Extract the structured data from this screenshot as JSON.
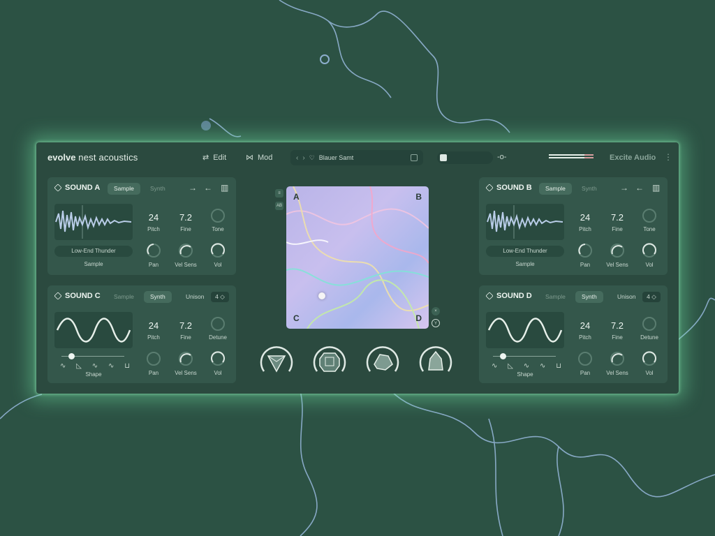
{
  "brand": {
    "bold": "evolve",
    "rest": " nest acoustics"
  },
  "header": {
    "edit_label": "Edit",
    "mod_label": "Mod",
    "preset_name": "Blauer Samt",
    "vendor": "Excite Audio",
    "menu": "⋮"
  },
  "sounds": {
    "a": {
      "title": "SOUND A",
      "tab_sample": "Sample",
      "tab_synth": "Synth",
      "pitch": "24",
      "pitch_label": "Pitch",
      "fine": "7.2",
      "fine_label": "Fine",
      "third_label": "Tone",
      "sample_name": "Low-End Thunder",
      "sample_label": "Sample",
      "pan_label": "Pan",
      "velsens_label": "Vel Sens",
      "vol_label": "Vol"
    },
    "b": {
      "title": "SOUND B",
      "tab_sample": "Sample",
      "tab_synth": "Synth",
      "pitch": "24",
      "pitch_label": "Pitch",
      "fine": "7.2",
      "fine_label": "Fine",
      "third_label": "Tone",
      "sample_name": "Low-End Thunder",
      "sample_label": "Sample",
      "pan_label": "Pan",
      "velsens_label": "Vel Sens",
      "vol_label": "Vol"
    },
    "c": {
      "title": "SOUND C",
      "tab_sample": "Sample",
      "tab_synth": "Synth",
      "unison_label": "Unison",
      "unison_value": "4 ◇",
      "pitch": "24",
      "pitch_label": "Pitch",
      "fine": "7.2",
      "fine_label": "Fine",
      "third_label": "Detune",
      "shape_label": "Shape",
      "pan_label": "Pan",
      "velsens_label": "Vel Sens",
      "vol_label": "Vol"
    },
    "d": {
      "title": "SOUND D",
      "tab_sample": "Sample",
      "tab_synth": "Synth",
      "unison_label": "Unison",
      "unison_value": "4 ◇",
      "pitch": "24",
      "pitch_label": "Pitch",
      "fine": "7.2",
      "fine_label": "Fine",
      "third_label": "Detune",
      "shape_label": "Shape",
      "pan_label": "Pan",
      "velsens_label": "Vel Sens",
      "vol_label": "Vol"
    }
  },
  "xy": {
    "a": "A",
    "b": "B",
    "c": "C",
    "d": "D"
  },
  "side_icons": {
    "ab": "AB"
  },
  "macros": [
    "triangle-gem-icon",
    "octagon-gem-icon",
    "rock-icon",
    "crystal-icon"
  ],
  "shapes": [
    "∿",
    "◺",
    "∿",
    "∿",
    "⊔"
  ],
  "colors": {
    "background": "#2c5244",
    "panel": "#34574b",
    "glow": "#6edca0",
    "accent": "#eef5f1"
  }
}
